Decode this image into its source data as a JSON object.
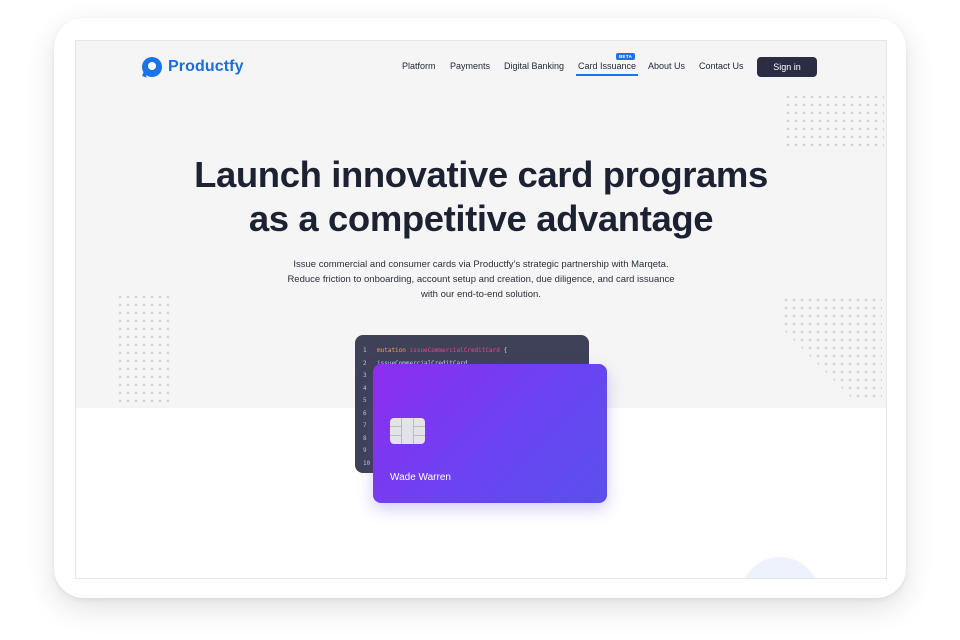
{
  "brand": {
    "name": "Productfy",
    "accent": "#1a73e8"
  },
  "nav": {
    "items": [
      {
        "label": "Platform"
      },
      {
        "label": "Payments"
      },
      {
        "label": "Digital Banking"
      },
      {
        "label": "Card Issuance",
        "badge": "BETA",
        "active": true
      },
      {
        "label": "About Us"
      },
      {
        "label": "Contact Us"
      }
    ],
    "signin_label": "Sign in"
  },
  "hero": {
    "headline": "Launch innovative card programs as a competitive advantage",
    "subtext": "Issue commercial and consumer cards via Productfy’s strategic partnership with Marqeta. Reduce friction to onboarding, account setup and creation, due diligence, and card issuance with our end-to-end solution."
  },
  "code": {
    "keyword": "mutation",
    "function": "issueCommercialCreditCard",
    "line2": "issueCommercialCreditCard",
    "line_numbers": [
      "1",
      "2",
      "3",
      "4",
      "5",
      "6",
      "7",
      "8",
      "9",
      "10"
    ]
  },
  "card": {
    "holder": "Wade Warren"
  }
}
